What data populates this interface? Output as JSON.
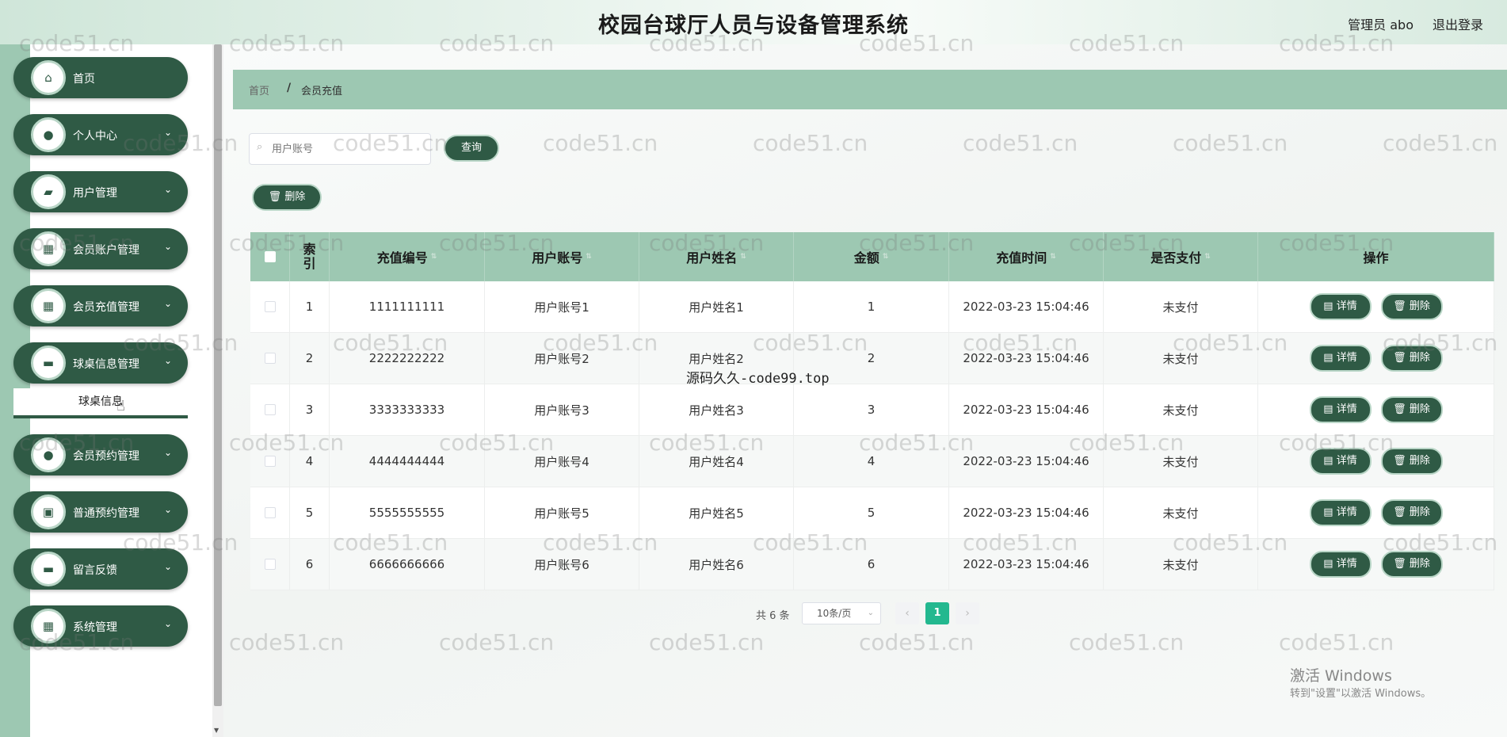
{
  "header": {
    "title": "校园台球厅人员与设备管理系统",
    "user": "管理员 abo",
    "logout": "退出登录"
  },
  "sidebar": {
    "items": [
      {
        "label": "首页",
        "icon": "home-icon",
        "glyph": "⌂",
        "chevron": false
      },
      {
        "label": "个人中心",
        "icon": "user-icon",
        "glyph": "●",
        "chevron": true
      },
      {
        "label": "用户管理",
        "icon": "wallet-icon",
        "glyph": "▰",
        "chevron": true
      },
      {
        "label": "会员账户管理",
        "icon": "grid-icon",
        "glyph": "▦",
        "chevron": true
      },
      {
        "label": "会员充值管理",
        "icon": "grid-icon",
        "glyph": "▦",
        "chevron": true
      },
      {
        "label": "球桌信息管理",
        "icon": "message-icon",
        "glyph": "▬",
        "chevron": true
      },
      {
        "label": "会员预约管理",
        "icon": "location-icon",
        "glyph": "●",
        "chevron": true
      },
      {
        "label": "普通预约管理",
        "icon": "clipboard-icon",
        "glyph": "▣",
        "chevron": true
      },
      {
        "label": "留言反馈",
        "icon": "monitor-icon",
        "glyph": "▬",
        "chevron": true
      },
      {
        "label": "系统管理",
        "icon": "grid-icon",
        "glyph": "▦",
        "chevron": true
      }
    ],
    "sub_item": "球桌信息",
    "chevron_glyph": "⌄"
  },
  "breadcrumb": {
    "home": "首页",
    "sep": "/",
    "current": "会员充值"
  },
  "search": {
    "placeholder": "用户账号",
    "query_label": "查询",
    "delete_label": "删除"
  },
  "table": {
    "headers": [
      "索引",
      "充值编号",
      "用户账号",
      "用户姓名",
      "金额",
      "充值时间",
      "是否支付",
      "操作"
    ],
    "rows": [
      [
        "1",
        "1111111111",
        "用户账号1",
        "用户姓名1",
        "1",
        "2022-03-23 15:04:46",
        "未支付"
      ],
      [
        "2",
        "2222222222",
        "用户账号2",
        "用户姓名2",
        "2",
        "2022-03-23 15:04:46",
        "未支付"
      ],
      [
        "3",
        "3333333333",
        "用户账号3",
        "用户姓名3",
        "3",
        "2022-03-23 15:04:46",
        "未支付"
      ],
      [
        "4",
        "4444444444",
        "用户账号4",
        "用户姓名4",
        "4",
        "2022-03-23 15:04:46",
        "未支付"
      ],
      [
        "5",
        "5555555555",
        "用户账号5",
        "用户姓名5",
        "5",
        "2022-03-23 15:04:46",
        "未支付"
      ],
      [
        "6",
        "6666666666",
        "用户账号6",
        "用户姓名6",
        "6",
        "2022-03-23 15:04:46",
        "未支付"
      ]
    ],
    "detail_label": "详情",
    "delete_label": "删除"
  },
  "pagination": {
    "total": "共 6 条",
    "page_size": "10条/页",
    "current_page": "1",
    "prev": "‹",
    "next": "›"
  },
  "watermark": {
    "text": "code51.cn",
    "caption": "源码久久-code99.top"
  },
  "os_notice": {
    "title": "激活 Windows",
    "subtitle": "转到\"设置\"以激活 Windows。"
  },
  "colors": {
    "accent": "#2f5a45",
    "header_green": "#9dc8b2",
    "active_page": "#23b88f"
  }
}
